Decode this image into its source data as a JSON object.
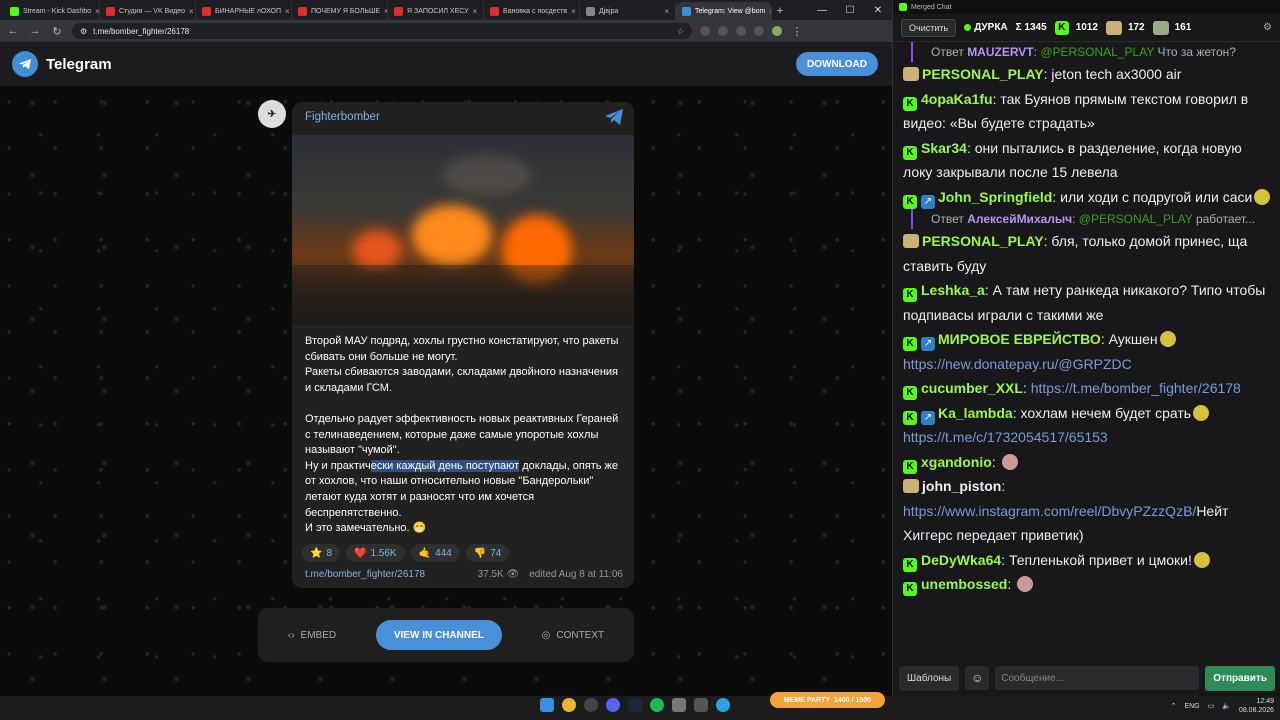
{
  "browser": {
    "tabs": [
      {
        "label": "Stream - Kick Dashbo",
        "color": "#53fc18"
      },
      {
        "label": "Студия — VK Видео",
        "color": "#e02f2f"
      },
      {
        "label": "БИНАРНЫЕ лОХОП",
        "color": "#e02f2f"
      },
      {
        "label": "ПОЧЕМУ Я БОЛЬШЕ",
        "color": "#e02f2f"
      },
      {
        "label": "Я ЗАПОСИЛ ХЕСУ",
        "color": "#e02f2f"
      },
      {
        "label": "Бановка с посдеств",
        "color": "#e02f2f"
      },
      {
        "label": "Дjвјра",
        "color": "#888888"
      },
      {
        "label": "Telegram: View @bom",
        "color": "#3e8fd8"
      }
    ],
    "url": "t.me/bomber_fighter/26178"
  },
  "telegram": {
    "brand": "Telegram",
    "download": "DOWNLOAD",
    "channel": "Fighterbomber",
    "post_text": [
      {
        "pre": "Второй МАУ подряд, хохлы грустно констатируют, что ракеты сбивать они больше не могут.\nРакеты сбиваются заводами, складами двойного назначения и складами ГСМ.\n\nОтдельно радует эффективность новых реактивных Гераней с телинаведением, которые даже самые упоротые хохлы называют \"чумой\".\nНу и практич",
        "hl": "ески каждый день поступают",
        "post": " доклады, опять же от хохлов, что наши относительно новые \"Бандерольки\" летают куда хотят и разносят что им хочется беспрепятственно.\nИ это замечательно. 😁"
      }
    ],
    "reactions": [
      {
        "icon": "⭐",
        "count": "8"
      },
      {
        "icon": "❤️",
        "count": "1.56K"
      },
      {
        "icon": "🤙",
        "count": "444"
      },
      {
        "icon": "👎",
        "count": "74"
      }
    ],
    "post_link": "t.me/bomber_fighter/26178",
    "views": "37.5K",
    "edited": "edited  Aug 8 at 11:06",
    "embed": "EMBED",
    "view_in_channel": "VIEW IN CHANNEL",
    "context": "CONTEXT"
  },
  "chat": {
    "window_title": "Merged Chat",
    "clear": "Очистить",
    "streamer": "ДУРКА",
    "total": "Σ 1345",
    "kick_count": "1012",
    "other_count": "172",
    "third_count": "161",
    "templates": "Шаблоны",
    "placeholder": "Сообщение...",
    "send": "Отправить",
    "messages": [
      {
        "type": "reply",
        "to": "MAUZERVT",
        "mention": "@PERSONAL_PLAY",
        "text": "Что за жетон?"
      },
      {
        "type": "msg",
        "badge": "g",
        "name": "PERSONAL_PLAY",
        "color": "#9cf84a",
        "text": "jeton tech ax3000 air"
      },
      {
        "type": "msg",
        "badge": "k",
        "name": "4opaKa1fu",
        "color": "#9cf84a",
        "text": "так Буянов прямым текстом говорил в видео: «Вы будете страдать»"
      },
      {
        "type": "msg",
        "badge": "k",
        "name": "Skar34",
        "color": "#9cf84a",
        "text": "они пытались в разделение, когда новую локу закрывали после 15 левела"
      },
      {
        "type": "msg",
        "badge": "ks",
        "name": "John_Springfield",
        "color": "#9cf84a",
        "text": "или ходи с подругой или саси"
      },
      {
        "type": "reply",
        "to": "АлексейМихалыч",
        "mention": "@PERSONAL_PLAY",
        "text": "работает..."
      },
      {
        "type": "msg",
        "badge": "g",
        "name": "PERSONAL_PLAY",
        "color": "#9cf84a",
        "text": "бля, только домой принес, ща ставить буду"
      },
      {
        "type": "msg",
        "badge": "k",
        "name": "Leshka_a",
        "color": "#9cf84a",
        "text": "А там нету ранкеда никакого? Типо чтобы подпивасы играли с такими же"
      },
      {
        "type": "msg",
        "badge": "ks",
        "name": "МИРОВОЕ ЕВРЕЙСТВО",
        "color": "#9cf84a",
        "text": "Аукшен",
        "link": "https://new.donatepay.ru/@GRPZDC"
      },
      {
        "type": "msg",
        "badge": "k",
        "name": "cucumber_XXL",
        "color": "#9cf84a",
        "text": "",
        "link": "https://t.me/bomber_fighter/26178"
      },
      {
        "type": "msg",
        "badge": "ks",
        "name": "Ka_lambda",
        "color": "#9cf84a",
        "text": "хохлам нечем будет срать",
        "link": "https://t.me/c/1732054517/65153"
      },
      {
        "type": "msg",
        "badge": "k",
        "name": "xgandonio",
        "color": "#9cf84a",
        "text": ""
      },
      {
        "type": "msg",
        "badge": "g",
        "name": "john_piston",
        "color": "#efeff1",
        "text": "Нейт Хиггерс передает приветик)",
        "link": "https://www.instagram.com/reel/DbvyPZzzQzB/"
      },
      {
        "type": "msg",
        "badge": "k",
        "name": "DeDyWka64",
        "color": "#9cf84a",
        "text": "Тепленькой привет и цмоки!"
      },
      {
        "type": "msg",
        "badge": "k",
        "name": "unembossed",
        "color": "#9cf84a",
        "text": ""
      }
    ]
  },
  "taskbar": {
    "meme": "MEME PARTY",
    "meme_progress": "1400 / 1500",
    "lang": "ENG",
    "time": "12:49",
    "date": "08.08.2026"
  }
}
